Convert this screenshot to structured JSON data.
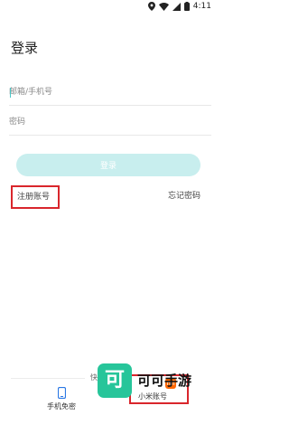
{
  "status_bar": {
    "time": "4:11"
  },
  "page": {
    "title": "登录"
  },
  "form": {
    "account_placeholder": "邮箱/手机号",
    "password_placeholder": "密码",
    "login_label": "登录"
  },
  "links": {
    "register": "注册账号",
    "forgot": "忘记密码"
  },
  "quick_login": {
    "heading": "快捷登录",
    "phone_label": "手机免密",
    "xiaomi_label": "小米账号",
    "xiaomi_logo": "mi"
  },
  "watermark": {
    "badge": "可",
    "text": "可可手游"
  },
  "colors": {
    "accent": "#c8eeee",
    "highlight_box": "#d9262c",
    "xiaomi": "#ff6700",
    "watermark": "#27c59a"
  }
}
